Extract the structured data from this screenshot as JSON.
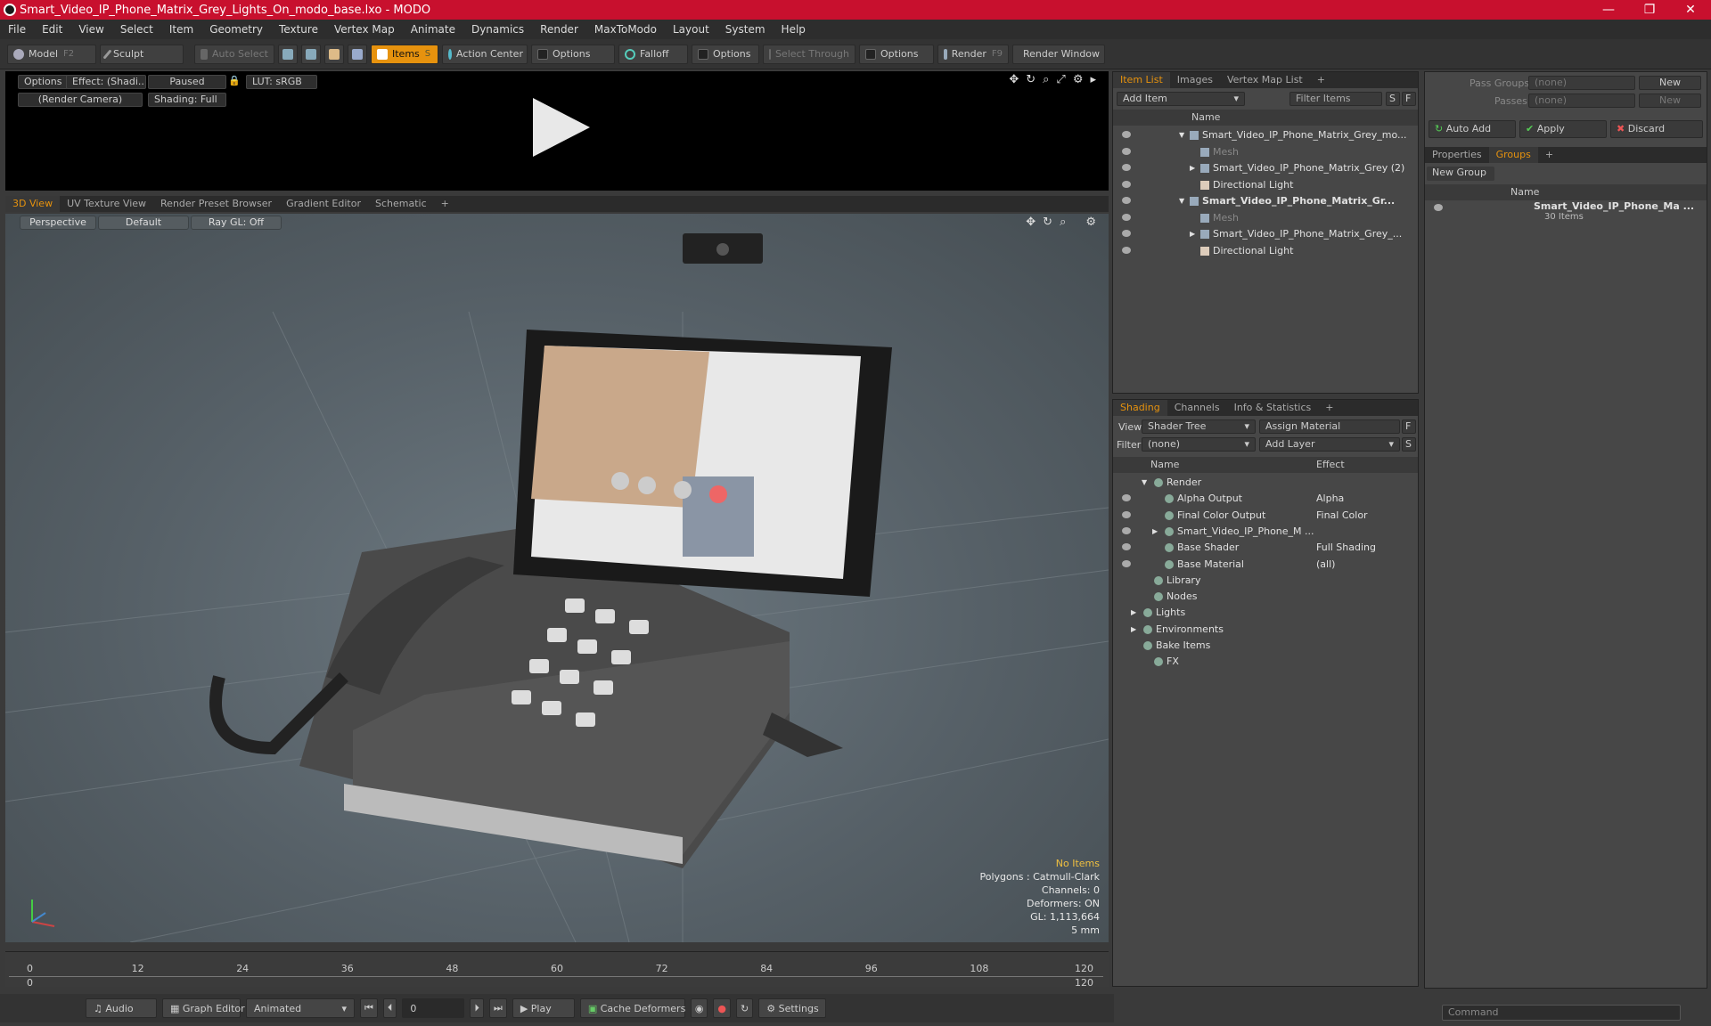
{
  "window": {
    "title": "Smart_Video_IP_Phone_Matrix_Grey_Lights_On_modo_base.lxo - MODO",
    "min": "—",
    "max": "❐",
    "close": "✕"
  },
  "menu": [
    "File",
    "Edit",
    "View",
    "Select",
    "Item",
    "Geometry",
    "Texture",
    "Vertex Map",
    "Animate",
    "Dynamics",
    "Render",
    "MaxToModo",
    "Layout",
    "System",
    "Help"
  ],
  "toolbar": {
    "model": "Model",
    "model_key": "F2",
    "sculpt": "Sculpt",
    "auto_select": "Auto Select",
    "items": "Items",
    "items_key": "S",
    "action_center": "Action Center",
    "options1": "Options",
    "falloff": "Falloff",
    "options2": "Options",
    "select_through": "Select Through",
    "options3": "Options",
    "render": "Render",
    "render_key": "F9",
    "render_window": "Render Window"
  },
  "preview": {
    "options": "Options",
    "effect": "Effect: (Shadi...",
    "paused": "Paused",
    "lut": "LUT: sRGB",
    "camera": "(Render Camera)",
    "shading": "Shading: Full"
  },
  "viewtabs": [
    "3D View",
    "UV Texture View",
    "Render Preset Browser",
    "Gradient Editor",
    "Schematic",
    "+"
  ],
  "viewport": {
    "perspective": "Perspective",
    "default": "Default",
    "raygl": "Ray GL: Off",
    "stats": {
      "no_items": "No Items",
      "polygons": "Polygons : Catmull-Clark",
      "channels": "Channels: 0",
      "deformers": "Deformers: ON",
      "gl": "GL: 1,113,664",
      "unit": "5 mm"
    }
  },
  "timeline": {
    "ticks": [
      "0",
      "12",
      "24",
      "36",
      "48",
      "60",
      "72",
      "84",
      "96",
      "108",
      "120"
    ],
    "start": "0",
    "end": "120"
  },
  "bottom": {
    "audio": "Audio",
    "graph_editor": "Graph Editor",
    "animated": "Animated",
    "frame": "0",
    "play": "Play",
    "cache": "Cache Deformers",
    "settings": "Settings"
  },
  "itemlist": {
    "tabs": [
      "Item List",
      "Images",
      "Vertex Map List",
      "+"
    ],
    "add_item": "Add Item",
    "filter": "Filter Items",
    "s": "S",
    "f": "F",
    "col_name": "Name",
    "rows": [
      {
        "name": "Smart_Video_IP_Phone_Matrix_Grey_mo...",
        "indent": 0,
        "arrow": "▼",
        "bold": false,
        "dim": false
      },
      {
        "name": "Mesh",
        "indent": 1,
        "arrow": "",
        "bold": false,
        "dim": true
      },
      {
        "name": "Smart_Video_IP_Phone_Matrix_Grey (2)",
        "indent": 1,
        "arrow": "▶",
        "bold": false,
        "dim": false
      },
      {
        "name": "Directional Light",
        "indent": 1,
        "arrow": "",
        "bold": false,
        "dim": false
      },
      {
        "name": "Smart_Video_IP_Phone_Matrix_Gr...",
        "indent": 0,
        "arrow": "▼",
        "bold": true,
        "dim": false
      },
      {
        "name": "Mesh",
        "indent": 1,
        "arrow": "",
        "bold": false,
        "dim": true
      },
      {
        "name": "Smart_Video_IP_Phone_Matrix_Grey_...",
        "indent": 1,
        "arrow": "▶",
        "bold": false,
        "dim": false
      },
      {
        "name": "Directional Light",
        "indent": 1,
        "arrow": "",
        "bold": false,
        "dim": false
      }
    ]
  },
  "shading": {
    "tabs": [
      "Shading",
      "Channels",
      "Info & Statistics",
      "+"
    ],
    "view_label": "View",
    "view_value": "Shader Tree",
    "assign": "Assign Material",
    "f": "F",
    "filter_label": "Filter",
    "filter_value": "(none)",
    "add_layer": "Add Layer",
    "s": "S",
    "col_name": "Name",
    "col_effect": "Effect",
    "rows": [
      {
        "name": "Render",
        "effect": "",
        "indent": 0,
        "arrow": "▼",
        "eye": false
      },
      {
        "name": "Alpha Output",
        "effect": "Alpha",
        "indent": 1,
        "arrow": "",
        "eye": true
      },
      {
        "name": "Final Color Output",
        "effect": "Final Color",
        "indent": 1,
        "arrow": "",
        "eye": true
      },
      {
        "name": "Smart_Video_IP_Phone_M ...",
        "effect": "",
        "indent": 1,
        "arrow": "▶",
        "eye": true
      },
      {
        "name": "Base Shader",
        "effect": "Full Shading",
        "indent": 1,
        "arrow": "",
        "eye": true
      },
      {
        "name": "Base Material",
        "effect": "(all)",
        "indent": 1,
        "arrow": "",
        "eye": true
      },
      {
        "name": "Library",
        "effect": "",
        "indent": 0,
        "arrow": "",
        "eye": false
      },
      {
        "name": "Nodes",
        "effect": "",
        "indent": 0,
        "arrow": "",
        "eye": false
      },
      {
        "name": "Lights",
        "effect": "",
        "indent": -1,
        "arrow": "▶",
        "eye": false
      },
      {
        "name": "Environments",
        "effect": "",
        "indent": -1,
        "arrow": "▶",
        "eye": false
      },
      {
        "name": "Bake Items",
        "effect": "",
        "indent": -1,
        "arrow": "",
        "eye": false
      },
      {
        "name": "FX",
        "effect": "",
        "indent": 0,
        "arrow": "",
        "eye": false
      }
    ]
  },
  "right": {
    "pass_groups": "Pass Groups",
    "passes": "Passes",
    "none": "(none)",
    "new": "New",
    "auto_add": "Auto Add",
    "apply": "Apply",
    "discard": "Discard",
    "tabs": [
      "Properties",
      "Groups",
      "+"
    ],
    "new_group": "New Group",
    "col_name": "Name",
    "group_name": "Smart_Video_IP_Phone_Ma ...",
    "group_count": "30 Items",
    "command": "Command"
  }
}
